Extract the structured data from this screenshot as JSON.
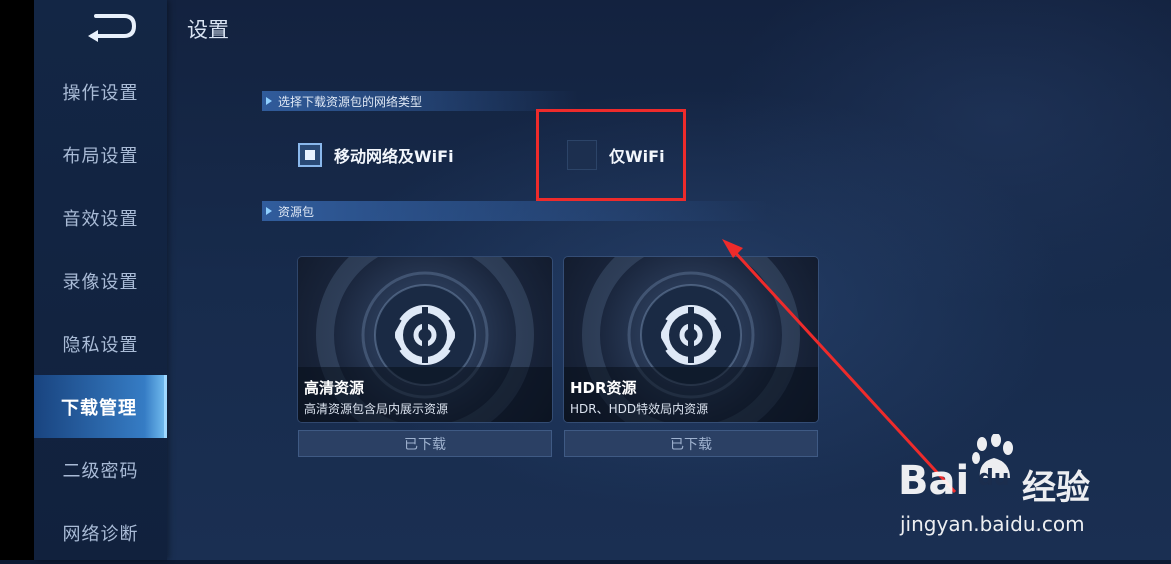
{
  "header": {
    "title": "设置"
  },
  "sidebar": {
    "items": [
      {
        "label": "操作设置"
      },
      {
        "label": "布局设置"
      },
      {
        "label": "音效设置"
      },
      {
        "label": "录像设置"
      },
      {
        "label": "隐私设置"
      },
      {
        "label": "下载管理",
        "active": true
      },
      {
        "label": "二级密码"
      },
      {
        "label": "网络诊断"
      }
    ]
  },
  "network": {
    "section_label": "选择下载资源包的网络类型",
    "options": [
      {
        "label": "移动网络及WiFi",
        "checked": true
      },
      {
        "label": "仅WiFi",
        "checked": false
      }
    ]
  },
  "packs": {
    "section_label": "资源包",
    "cards": [
      {
        "title": "高清资源",
        "desc": "高清资源包含局内展示资源",
        "button": "已下载"
      },
      {
        "title": "HDR资源",
        "desc": "HDR、HDD特效局内资源",
        "button": "已下载"
      }
    ]
  },
  "watermark": {
    "logo_text": "Bai",
    "logo_text2": "du",
    "brand": "经验",
    "url": "jingyan.baidu.com"
  },
  "colors": {
    "annotation_red": "#ee2b2b",
    "active_tab": "#3c8cdc"
  },
  "icons": {
    "back": "back-arrow-icon",
    "pack": "pack-emblem-icon",
    "paw": "baidu-paw-icon"
  }
}
